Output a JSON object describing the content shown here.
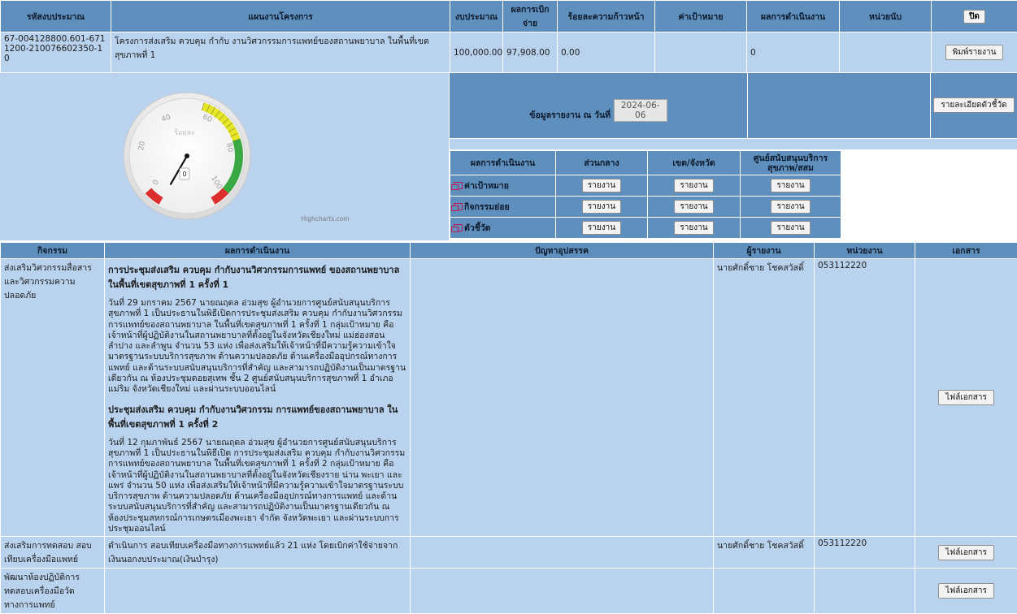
{
  "header": {
    "budget_code": "รหัสงบประมาณ",
    "project_plan": "แผนงานโครงการ",
    "budget": "งบประมาณ",
    "disbursed": "ผลการเบิกจ่าย",
    "progress_pct": "ร้อยละความก้าวหน้า",
    "target": "ค่าเป้าหมาย",
    "performance": "ผลการดำเนินงาน",
    "unit": "หน่วยนับ",
    "close_label": "ปิด"
  },
  "project": {
    "code": "67-004128800.601-6711200-210076602350-10",
    "name": "โครงการส่งเสริม ควบคุม กำกับ งานวิศวกรรมการแพทย์ของสถานพยาบาล ในพื้นที่เขตสุขภาพที่ 1",
    "budget": "100,000.00",
    "disbursed": "97,908.00",
    "progress": "0.00",
    "target": "",
    "performance": "0",
    "unit": "",
    "print_label": "พิมพ์รายงาน"
  },
  "gauge": {
    "label": "ร้อยละ",
    "value": 0,
    "value_text": "0",
    "ticks": [
      "0",
      "20",
      "40",
      "60",
      "80",
      "100"
    ],
    "credit": "Highcharts.com",
    "colors": {
      "red": "#dd2e2e",
      "yellow": "#e6e629",
      "green": "#3aa843"
    }
  },
  "report": {
    "date_label": "ข้อมูลรายงาน ณ วันที่",
    "date_value": "2024-06-06",
    "indicator_detail_label": "รายละเอียดตัวชี้วัด"
  },
  "results": {
    "headers": [
      "ผลการดำเนินงาน",
      "ส่วนกลาง",
      "เขต/จังหวัด",
      "ศูนย์สนับสนุนบริการสุขภาพ/สสม"
    ],
    "button_label": "รายงาน",
    "rows": [
      "ค่าเป้าหมาย",
      "กิจกรรมย่อย",
      "ตัวชี้วัด"
    ]
  },
  "activities": {
    "headers": [
      "กิจกรรม",
      "ผลการดำเนินงาน",
      "ปัญหาอุปสรรค",
      "ผู้รายงาน",
      "หน่วยงาน",
      "เอกสาร"
    ],
    "doc_label": "ไฟล์เอกสาร",
    "rows": [
      {
        "name": "ส่งเสริมวิศวกรรมสื่อสารและวิศวกรรมความปลอดภัย",
        "title1": "การประชุมส่งเสริม ควบคุม กำกับงานวิศวกรรมการแพทย์ ของสถานพยาบาล ในพื้นที่เขตสุขภาพที่ 1 ครั้งที่ 1",
        "body1": "วันที่ 29 มกราคม 2567 นายณฤดล อ่วมสุข ผู้อำนวยการศูนย์สนับสนุนบริการสุขภาพที่ 1 เป็นประธานในพิธีเปิดการประชุมส่งเสริม ควบคุม กำกับงานวิศวกรรมการแพทย์ของสถานพยาบาล ในพื้นที่เขตสุขภาพที่ 1 ครั้งที่ 1 กลุ่มเป้าหมาย คือ เจ้าหน้าที่ผู้ปฏิบัติงานในสถานพยาบาลที่ตั้งอยู่ในจังหวัดเชียงใหม่ แม่ฮ่องสอน ลำปาง และลำพูน จำนวน 53 แห่ง เพื่อส่งเสริมให้เจ้าหน้าที่มีความรู้ความเข้าใจมาตรฐานระบบบริการสุขภาพ ด้านความปลอดภัย ด้านเครื่องมืออุปกรณ์ทางการแพทย์ และด้านระบบสนับสนุนบริการที่สำคัญ และสามารถปฏิบัติงานเป็นมาตรฐานเดียวกัน ณ ห้องประชุมดอยสุเทพ ชั้น 2 ศูนย์สนับสนุนบริการสุขภาพที่ 1 อำเภอแม่ริม จังหวัดเชียงใหม่ และผ่านระบบออนไลน์",
        "title2": "ประชุมส่งเสริม ควบคุม กำกับงานวิศวกรรม การแพทย์ของสถานพยาบาล ในพื้นที่เขตสุขภาพที่ 1 ครั้งที่ 2",
        "body2": "วันที่ 12 กุมภาพันธ์ 2567 นายณฤดล อ่วมสุข ผู้อำนวยการศูนย์สนับสนุนบริการสุขภาพที่ 1 เป็นประธานในพิธีเปิด การประชุมส่งเสริม ควบคุม กำกับงานวิศวกรรมการแพทย์ของสถานพยาบาล ในพื้นที่เขตสุขภาพที่ 1 ครั้งที่ 2 กลุ่มเป้าหมาย คือ เจ้าหน้าที่ผู้ปฏิบัติงานในสถานพยาบาลที่ตั้งอยู่ในจังหวัดเชียงราย น่าน พะเยา และแพร่ จำนวน 50 แห่ง เพื่อส่งเสริมให้เจ้าหน้าที่มีความรู้ความเข้าใจมาตรฐานระบบบริการสุขภาพ ด้านความปลอดภัย ด้านเครื่องมืออุปกรณ์ทางการแพทย์ และด้านระบบสนับสนุนบริการที่สำคัญ และสามารถปฏิบัติงานเป็นมาตรฐานเดียวกัน ณ ห้องประชุมสหกรณ์การเกษตรเมืองพะเยา จำกัด จังหวัดพะเยา และผ่านระบบการประชุมออนไลน์",
        "problem": "",
        "reporter": "นายศักดิ์ชาย โชคสวัสดิ์",
        "agency": "053112220"
      },
      {
        "name": "ส่งเสริมการทดสอบ สอบเทียบเครื่องมือแพทย์",
        "result": "ดำเนินการ สอบเทียบเครื่องมือทางการแพทย์แล้ว 21 แห่ง โดยเบิกค่าใช้จ่ายจากเงินนอกงบประมาณ(เงินบำรุง)",
        "problem": "",
        "reporter": "นายศักดิ์ชาย โชคสวัสดิ์",
        "agency": "053112220"
      },
      {
        "name": "พัฒนาห้องปฏิบัติการทดสอบเครื่องมือวัดทางการแพทย์",
        "result": "",
        "problem": "",
        "reporter": "",
        "agency": ""
      }
    ]
  }
}
